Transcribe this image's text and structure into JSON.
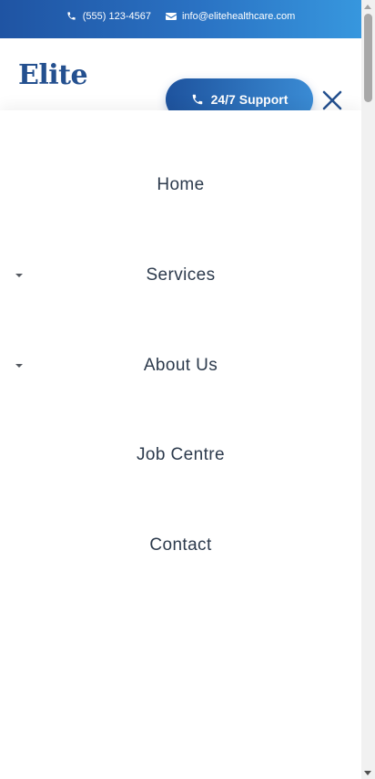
{
  "topbar": {
    "phone_icon": "phone-icon",
    "phone": "(555) 123-4567",
    "email_icon": "envelope-icon",
    "email": "info@elitehealthcare.com"
  },
  "header": {
    "logo": "Elite",
    "support_button_label": "24/7 Support",
    "support_button_icon": "phone-icon",
    "close_icon": "close-icon"
  },
  "menu": {
    "items": [
      {
        "label": "Home",
        "has_submenu": false
      },
      {
        "label": "Services",
        "has_submenu": true
      },
      {
        "label": "About Us",
        "has_submenu": true
      },
      {
        "label": "Job Centre",
        "has_submenu": false
      },
      {
        "label": "Contact",
        "has_submenu": false
      }
    ]
  },
  "colors": {
    "brand": "#24508f",
    "accent": "#3a8bd4",
    "menu_text": "#2c3a4c"
  }
}
